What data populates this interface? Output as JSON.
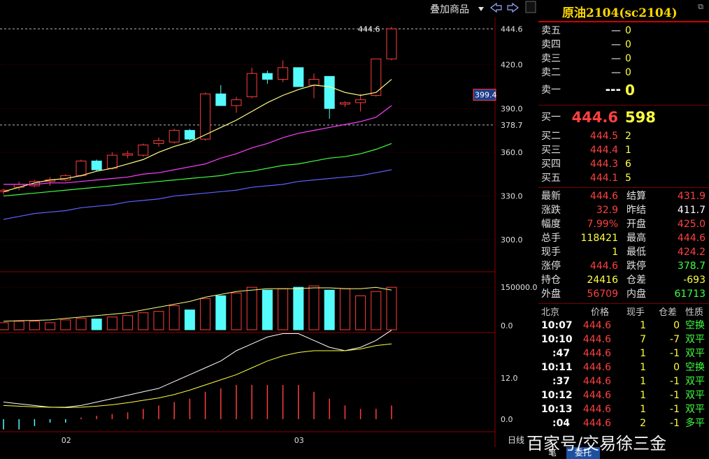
{
  "toolbar": {
    "overlay_label": "叠加商品",
    "dropdown_icon": "caret-down-icon",
    "prev_icon": "arrow-left-icon",
    "next_icon": "arrow-right-icon"
  },
  "symbol": {
    "title": "原油2104(sc2104)"
  },
  "chart_data": {
    "type": "candlestick",
    "period_label": "日线",
    "x_labels": [
      {
        "index": 4,
        "label": "02"
      },
      {
        "index": 19,
        "label": "03"
      }
    ],
    "price_axis": {
      "ticks": [
        "444.6",
        "420.0",
        "390.0",
        "378.7",
        "360.0",
        "330.0",
        "300.0"
      ],
      "ylim": [
        280,
        450
      ]
    },
    "last_price_label": "444.6",
    "limit_down_line": 378.7,
    "cursor_price": "399.4",
    "candles": [
      [
        333,
        335,
        331,
        334
      ],
      [
        336,
        340,
        334,
        338
      ],
      [
        337,
        341,
        336,
        340
      ],
      [
        340,
        343,
        337,
        341
      ],
      [
        341,
        345,
        340,
        344
      ],
      [
        344,
        355,
        343,
        354
      ],
      [
        354,
        355,
        347,
        348
      ],
      [
        349,
        360,
        348,
        358
      ],
      [
        358,
        361,
        356,
        359
      ],
      [
        358,
        366,
        357,
        365
      ],
      [
        366,
        370,
        364,
        368
      ],
      [
        367,
        376,
        366,
        375
      ],
      [
        375,
        376,
        368,
        369
      ],
      [
        369,
        401,
        368,
        400
      ],
      [
        400,
        406,
        396,
        392
      ],
      [
        392,
        398,
        387,
        396
      ],
      [
        398,
        418,
        397,
        414
      ],
      [
        414,
        416,
        407,
        410
      ],
      [
        410,
        423,
        408,
        418
      ],
      [
        418,
        416,
        405,
        405
      ],
      [
        406,
        414,
        397,
        410
      ],
      [
        412,
        412,
        383,
        390
      ],
      [
        393,
        395,
        391,
        394
      ],
      [
        394,
        400,
        388,
        396
      ],
      [
        399,
        424,
        398,
        424
      ],
      [
        424,
        446,
        423,
        444.6
      ]
    ],
    "ma_series": [
      {
        "color": "#ffff80",
        "values": [
          333,
          336,
          339,
          341,
          342,
          344,
          347,
          349,
          352,
          355,
          360,
          364,
          367,
          372,
          377,
          382,
          388,
          394,
          399,
          403,
          406,
          405,
          401,
          399,
          401,
          410
        ]
      },
      {
        "color": "#ff40ff",
        "values": [
          338,
          338,
          338,
          339,
          339,
          340,
          341,
          342,
          343,
          345,
          346,
          348,
          350,
          352,
          356,
          359,
          363,
          366,
          370,
          373,
          375,
          377,
          379,
          381,
          384,
          392
        ]
      },
      {
        "color": "#40ff40",
        "values": [
          330,
          331,
          332,
          333,
          334,
          335,
          336,
          337,
          338,
          339,
          340,
          341,
          342,
          343,
          344,
          346,
          347,
          349,
          351,
          352,
          354,
          356,
          357,
          359,
          362,
          366
        ]
      },
      {
        "color": "#6060ff",
        "values": [
          314,
          316,
          318,
          319,
          320,
          322,
          323,
          324,
          326,
          327,
          328,
          330,
          331,
          332,
          333,
          334,
          336,
          337,
          338,
          340,
          341,
          342,
          343,
          344,
          346,
          348
        ]
      }
    ],
    "volume": {
      "axis_ticks": [
        "150000.0",
        "0.0"
      ],
      "values": [
        25,
        30,
        30,
        25,
        35,
        40,
        38,
        45,
        50,
        60,
        65,
        85,
        70,
        110,
        120,
        130,
        150,
        140,
        145,
        150,
        155,
        140,
        145,
        120,
        135,
        150
      ],
      "ma": [
        30,
        32,
        33,
        35,
        40,
        45,
        50,
        55,
        60,
        70,
        80,
        90,
        100,
        115,
        125,
        135,
        140,
        145,
        145,
        145,
        148,
        148,
        145,
        145,
        150,
        140
      ]
    },
    "macd": {
      "axis_ticks": [
        "12.0",
        "0.0"
      ],
      "hist": [
        -3,
        -3,
        -2,
        -1,
        -1,
        0.5,
        1,
        1.5,
        2,
        3,
        4,
        5,
        6,
        8,
        9,
        10,
        10,
        10,
        10,
        10,
        8,
        6,
        4,
        3,
        3,
        4
      ],
      "dif": [
        5,
        4.5,
        4,
        3.5,
        3.5,
        4,
        5,
        6,
        7,
        8,
        9,
        11,
        13,
        15,
        17,
        20,
        22,
        24,
        25,
        25,
        23,
        21,
        20,
        21,
        23,
        26
      ],
      "dea": [
        4,
        3.8,
        3.6,
        3.5,
        3.4,
        3.5,
        3.8,
        4.2,
        4.8,
        5.5,
        6.2,
        7.2,
        8.5,
        10,
        11.5,
        13,
        15,
        17,
        18.5,
        19.5,
        20,
        20,
        20,
        20.5,
        21.5,
        22
      ]
    }
  },
  "order_book": {
    "asks": [
      {
        "label": "卖五",
        "price": "—",
        "vol": "0"
      },
      {
        "label": "卖四",
        "price": "—",
        "vol": "0"
      },
      {
        "label": "卖三",
        "price": "—",
        "vol": "0"
      },
      {
        "label": "卖二",
        "price": "—",
        "vol": "0"
      },
      {
        "label": "卖一",
        "price": "---",
        "vol": "0"
      }
    ],
    "bid1": {
      "label": "买一",
      "price": "444.6",
      "vol": "598"
    },
    "bids": [
      {
        "label": "买二",
        "price": "444.5",
        "vol": "2"
      },
      {
        "label": "买三",
        "price": "444.4",
        "vol": "1"
      },
      {
        "label": "买四",
        "price": "444.3",
        "vol": "6"
      },
      {
        "label": "买五",
        "price": "444.1",
        "vol": "5"
      }
    ]
  },
  "quote": [
    {
      "l1": "最新",
      "v1": "444.6",
      "c1": "red",
      "l2": "结算",
      "v2": "431.9",
      "c2": "red"
    },
    {
      "l1": "涨跌",
      "v1": "32.9",
      "c1": "red",
      "l2": "昨结",
      "v2": "411.7",
      "c2": "white"
    },
    {
      "l1": "幅度",
      "v1": "7.99%",
      "c1": "red",
      "l2": "开盘",
      "v2": "425.0",
      "c2": "red"
    },
    {
      "l1": "总手",
      "v1": "118421",
      "c1": "yellow",
      "l2": "最高",
      "v2": "444.6",
      "c2": "red"
    },
    {
      "l1": "现手",
      "v1": "1",
      "c1": "yellow",
      "l2": "最低",
      "v2": "424.2",
      "c2": "red"
    },
    {
      "l1": "涨停",
      "v1": "444.6",
      "c1": "red",
      "l2": "跌停",
      "v2": "378.7",
      "c2": "green"
    },
    {
      "l1": "持仓",
      "v1": "24416",
      "c1": "yellow",
      "l2": "仓差",
      "v2": "-693",
      "c2": "yellow"
    },
    {
      "l1": "外盘",
      "v1": "56709",
      "c1": "red",
      "l2": "内盘",
      "v2": "61713",
      "c2": "green"
    }
  ],
  "ticks_header": {
    "market": "北京",
    "price": "价格",
    "qty": "现手",
    "diff": "仓差",
    "nature": "性质"
  },
  "ticks": [
    {
      "time": "10:07",
      "price": "444.6",
      "qty": "1",
      "diff": "0",
      "nature": "空换"
    },
    {
      "time": "10:10",
      "price": "444.6",
      "qty": "7",
      "diff": "-7",
      "nature": "双平"
    },
    {
      "time": ":47",
      "price": "444.6",
      "qty": "1",
      "diff": "-1",
      "nature": "双平"
    },
    {
      "time": "10:11",
      "price": "444.6",
      "qty": "1",
      "diff": "0",
      "nature": "空换"
    },
    {
      "time": ":37",
      "price": "444.6",
      "qty": "1",
      "diff": "-1",
      "nature": "双平"
    },
    {
      "time": "10:12",
      "price": "444.6",
      "qty": "1",
      "diff": "-1",
      "nature": "双平"
    },
    {
      "time": "10:13",
      "price": "444.6",
      "qty": "1",
      "diff": "-1",
      "nature": "双平"
    },
    {
      "time": ":04",
      "price": "444.6",
      "qty": "2",
      "diff": "-1",
      "nature": "多平"
    }
  ],
  "tabs": {
    "left": "笔",
    "active": "委托"
  },
  "watermark": "百家号/交易徐三金"
}
